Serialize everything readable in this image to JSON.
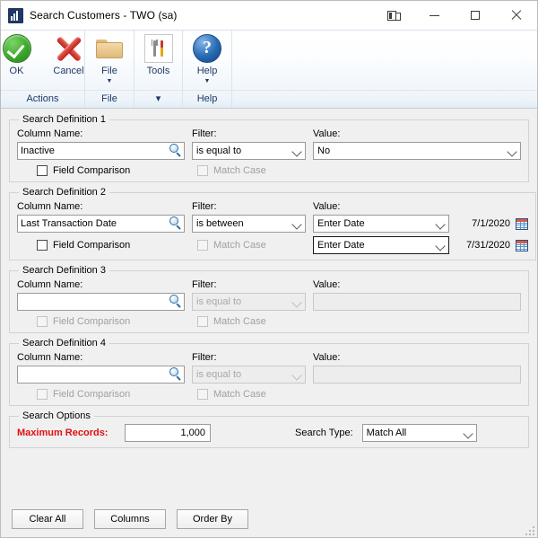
{
  "window": {
    "title": "Search Customers  -  TWO (sa)",
    "icon": "chart-icon",
    "controls": {
      "layout": "layout-icon",
      "minimize": "minimize-icon",
      "maximize": "maximize-icon",
      "close": "close-icon"
    }
  },
  "ribbon": {
    "groups": [
      {
        "label": "Actions",
        "buttons": [
          {
            "label": "OK",
            "icon": "green-check-icon",
            "arrow": ""
          },
          {
            "label": "Cancel",
            "icon": "red-x-icon",
            "arrow": ""
          }
        ]
      },
      {
        "label": "File",
        "buttons": [
          {
            "label": "File",
            "icon": "folder-icon",
            "arrow": "▼"
          }
        ]
      },
      {
        "label": "▾",
        "buttons": [
          {
            "label": "Tools",
            "icon": "tools-icon",
            "arrow": ""
          }
        ]
      },
      {
        "label": "Help",
        "buttons": [
          {
            "label": "Help",
            "icon": "help-icon",
            "arrow": "▼"
          }
        ]
      }
    ]
  },
  "labels": {
    "column_name": "Column Name:",
    "filter": "Filter:",
    "value": "Value:",
    "field_comparison": "Field Comparison",
    "match_case": "Match Case"
  },
  "definitions": [
    {
      "legend": "Search Definition 1",
      "column_name": "Inactive",
      "column_name_placeholder": "",
      "filter": "is equal to",
      "value": "No",
      "value_type": "select",
      "field_comparison_checked": false,
      "field_comparison_enabled": true,
      "match_case_checked": false,
      "match_case_enabled": false,
      "enabled": true
    },
    {
      "legend": "Search Definition 2",
      "column_name": "Last Transaction Date",
      "column_name_placeholder": "",
      "filter": "is between",
      "value": "Enter Date",
      "value_type": "date",
      "date_from": "7/1/2020",
      "value2": "Enter Date",
      "date_to": "7/31/2020",
      "field_comparison_checked": false,
      "field_comparison_enabled": true,
      "match_case_checked": false,
      "match_case_enabled": false,
      "enabled": true
    },
    {
      "legend": "Search Definition 3",
      "column_name": "",
      "column_name_placeholder": "",
      "filter": "is equal to",
      "value": "",
      "value_type": "text",
      "field_comparison_checked": false,
      "field_comparison_enabled": false,
      "match_case_checked": false,
      "match_case_enabled": false,
      "enabled": false
    },
    {
      "legend": "Search Definition 4",
      "column_name": "",
      "column_name_placeholder": "",
      "filter": "is equal to",
      "value": "",
      "value_type": "text",
      "field_comparison_checked": false,
      "field_comparison_enabled": false,
      "match_case_checked": false,
      "match_case_enabled": false,
      "enabled": false
    }
  ],
  "search_options": {
    "legend": "Search Options",
    "maximum_records_label": "Maximum Records:",
    "maximum_records_value": "1,000",
    "maximum_records_color": "#e01010",
    "search_type_label": "Search Type:",
    "search_type_value": "Match All"
  },
  "footer": {
    "clear_all": "Clear All",
    "columns": "Columns",
    "order_by": "Order By"
  },
  "icons": {
    "lookup": "magnifier-icon",
    "calendar": "calendar-icon",
    "chevron": "chevron-down-icon"
  }
}
